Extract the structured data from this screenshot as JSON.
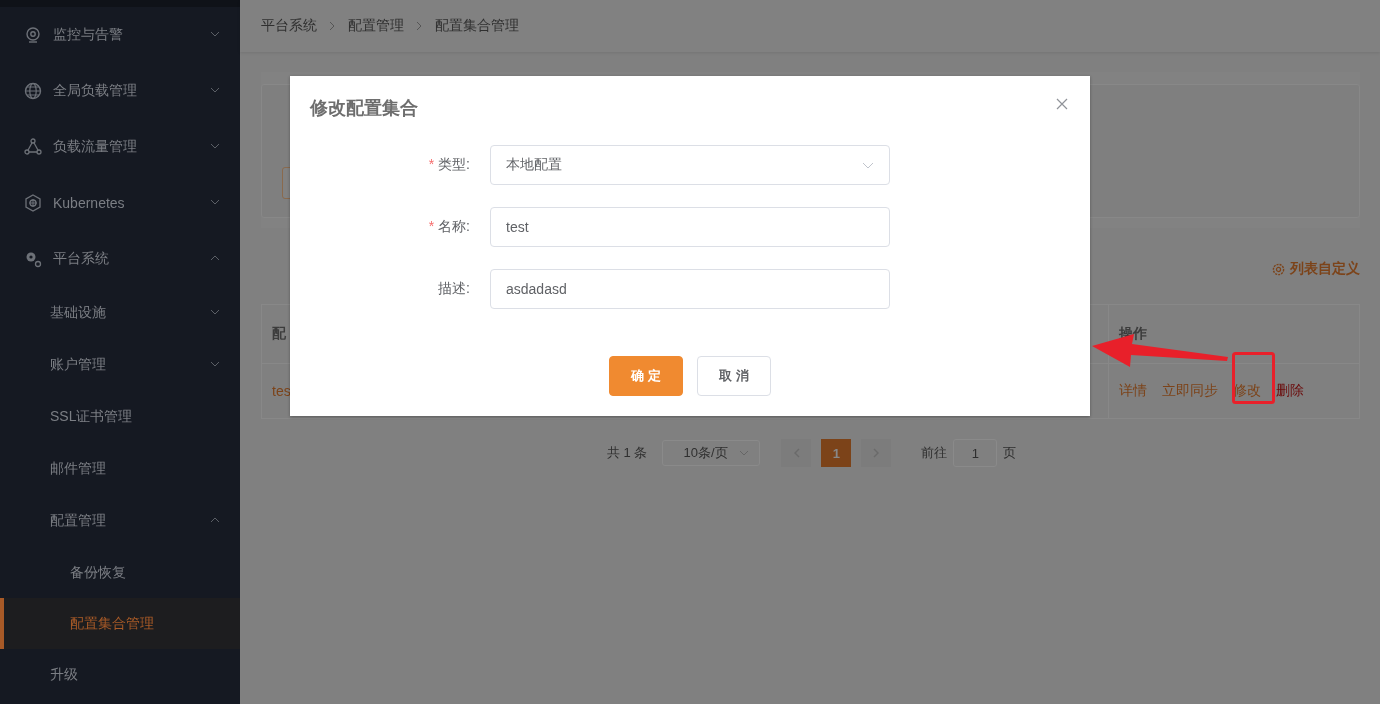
{
  "sidebar": {
    "items": [
      {
        "label": "监控与告警",
        "kind": "monitor",
        "expanded": false,
        "selected": false
      },
      {
        "label": "全局负载管理",
        "kind": "globe",
        "expanded": false,
        "selected": false
      },
      {
        "label": "负载流量管理",
        "kind": "nodes",
        "expanded": false,
        "selected": false
      },
      {
        "label": "Kubernetes",
        "kind": "helm",
        "expanded": false,
        "selected": false
      },
      {
        "label": "平台系统",
        "kind": "gears",
        "expanded": true,
        "selected": false,
        "children": [
          {
            "label": "基础设施",
            "expanded": false,
            "selected": false
          },
          {
            "label": "账户管理",
            "expanded": false,
            "selected": false
          },
          {
            "label": "SSL证书管理",
            "selected": false
          },
          {
            "label": "邮件管理",
            "selected": false
          },
          {
            "label": "配置管理",
            "expanded": true,
            "selected": false,
            "children": [
              {
                "label": "备份恢复",
                "selected": false
              },
              {
                "label": "配置集合管理",
                "selected": true
              }
            ]
          },
          {
            "label": "升级",
            "selected": false
          }
        ]
      }
    ]
  },
  "breadcrumb": [
    "平台系统",
    "配置管理",
    "配置集合管理"
  ],
  "list_settings": "列表自定义",
  "table": {
    "columns": [
      "配",
      "操作"
    ],
    "rows": [
      {
        "column_1": "tes",
        "actions": [
          {
            "label": "详情",
            "kind": "normal"
          },
          {
            "label": "立即同步",
            "kind": "normal"
          },
          {
            "label": "修改",
            "kind": "normal"
          },
          {
            "label": "删除",
            "kind": "danger"
          }
        ]
      }
    ]
  },
  "pagination": {
    "total": "共 1 条",
    "page_size": "10条/页",
    "pages": [
      {
        "label": "1",
        "selected": true
      }
    ],
    "goto_label": "前往",
    "goto_value": "1",
    "goto_suffix": "页"
  },
  "dialog": {
    "title": "修改配置集合",
    "fields": [
      {
        "label": "类型:",
        "required_mark": "*",
        "kind": "select",
        "value": "本地配置"
      },
      {
        "label": "名称:",
        "required_mark": "*",
        "kind": "input",
        "value": "test"
      },
      {
        "label": "描述:",
        "kind": "input",
        "value": "asdadasd"
      }
    ],
    "buttons": [
      {
        "label": "确 定",
        "kind": "primary"
      },
      {
        "label": "取 消",
        "kind": "default"
      }
    ]
  }
}
